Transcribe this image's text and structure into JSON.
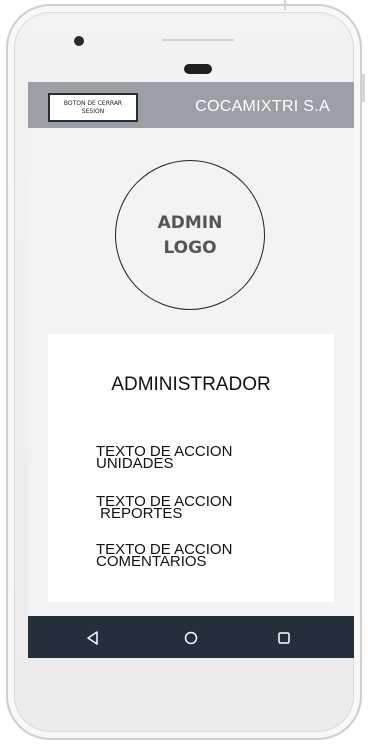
{
  "app_bar": {
    "logout_line1": "BOTON DE CERRAR",
    "logout_line2": "SESION",
    "title": "COCAMIXTRI S.A"
  },
  "logo": {
    "line1": "ADMIN",
    "line2": "LOGO"
  },
  "card": {
    "title": "ADMINISTRADOR",
    "actions": [
      {
        "line1": "TEXTO DE ACCION",
        "line2": "UNIDADES"
      },
      {
        "line1": "TEXTO DE ACCION",
        "line2": " REPORTES"
      },
      {
        "line1": "TEXTO DE ACCION",
        "line2": "COMENTARIOS"
      }
    ]
  },
  "nav_bar": {
    "icons": [
      "back-icon",
      "home-icon",
      "recents-icon"
    ]
  },
  "colors": {
    "app_bar": "#9aa0a6",
    "nav_bar": "#232f3a",
    "screen_background": "#f2f3f5"
  }
}
